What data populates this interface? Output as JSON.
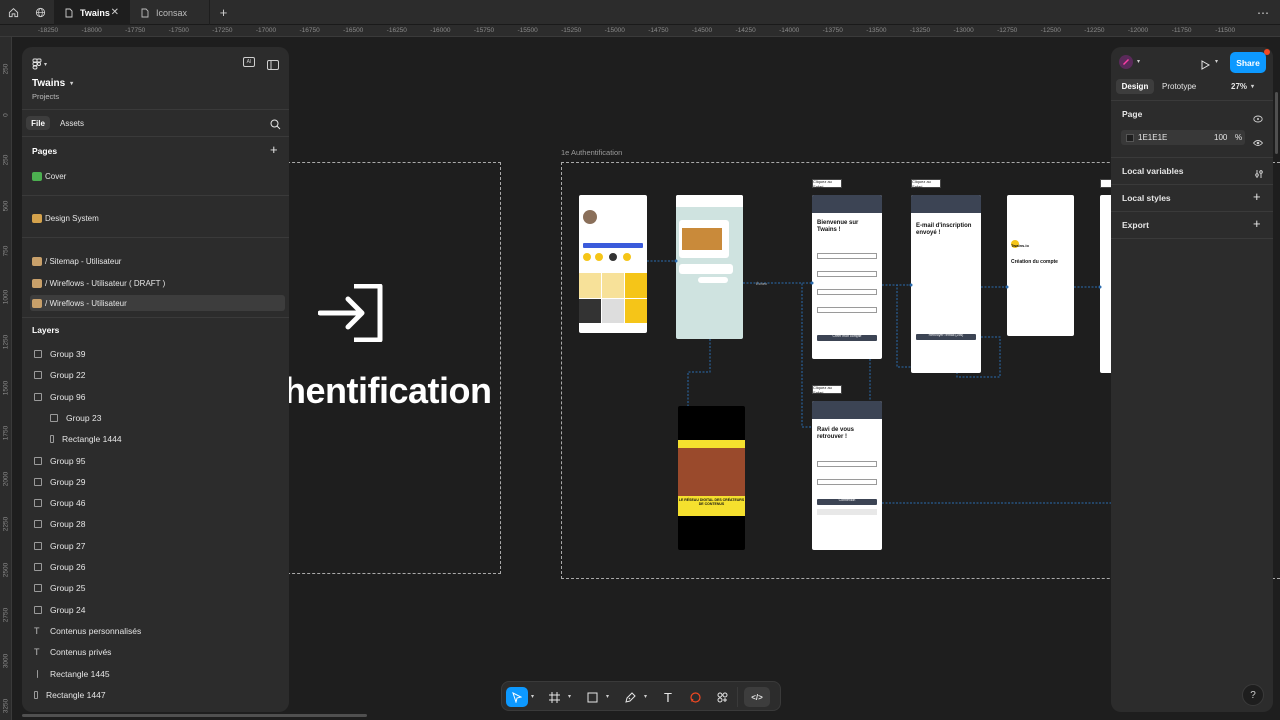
{
  "tabs": [
    {
      "label": "Twains",
      "active": true
    },
    {
      "label": "Iconsax",
      "active": false
    }
  ],
  "ruler_top": [
    "-18250",
    "-18000",
    "-17750",
    "-17500",
    "-17250",
    "-17000",
    "-16750",
    "-16500",
    "-16250",
    "-16000",
    "-15750",
    "-15500",
    "-15250",
    "-15000",
    "-14750",
    "-14500",
    "-14250",
    "-14000",
    "-13750",
    "-13500",
    "-13250",
    "-13000",
    "-12750",
    "-12500",
    "-12250",
    "-12000",
    "-11750",
    "-11500"
  ],
  "ruler_left": [
    "250",
    "0",
    "250",
    "500",
    "750",
    "1000",
    "1250",
    "1500",
    "1750",
    "2000",
    "2250",
    "2500",
    "2750",
    "3000",
    "3250"
  ],
  "project": {
    "name": "Twains",
    "subtitle": "Projects"
  },
  "panel_tabs": {
    "file": "File",
    "assets": "Assets"
  },
  "pages": {
    "heading": "Pages",
    "items": [
      {
        "label": "Cover",
        "emoji_color": "#4caf50"
      },
      {
        "label": "Design System",
        "emoji_color": "#d4a24c"
      },
      {
        "label": "/ Sitemap - Utilisateur",
        "emoji_color": "#c8a06a"
      },
      {
        "label": "/ Wireflows - Utilisateur ( DRAFT )",
        "emoji_color": "#c8a06a"
      },
      {
        "label": "/ Wireflows - Utilisateur",
        "emoji_color": "#c8a06a",
        "selected": true
      }
    ]
  },
  "layers": {
    "heading": "Layers",
    "items": [
      {
        "label": "Group 39",
        "type": "group"
      },
      {
        "label": "Group 22",
        "type": "group"
      },
      {
        "label": "Group 96",
        "type": "group"
      },
      {
        "label": "Group 23",
        "type": "group",
        "indent": 1
      },
      {
        "label": "Rectangle 1444",
        "type": "rect",
        "indent": 1
      },
      {
        "label": "Group 95",
        "type": "group"
      },
      {
        "label": "Group 29",
        "type": "group"
      },
      {
        "label": "Group 46",
        "type": "group"
      },
      {
        "label": "Group 28",
        "type": "group"
      },
      {
        "label": "Group 27",
        "type": "group"
      },
      {
        "label": "Group 26",
        "type": "group"
      },
      {
        "label": "Group 25",
        "type": "group"
      },
      {
        "label": "Group 24",
        "type": "group"
      },
      {
        "label": "Contenus personnalisés",
        "type": "text"
      },
      {
        "label": "Contenus privés",
        "type": "text"
      },
      {
        "label": "Rectangle 1445",
        "type": "line"
      },
      {
        "label": "Rectangle 1447",
        "type": "rect"
      }
    ]
  },
  "canvas": {
    "cover_title": "hentification",
    "section_label": "1e Authentification",
    "screens": {
      "signup_title": "Bienvenue sur Twains !",
      "signup_btn": "Créer mon compte",
      "email_title": "E-mail d'inscription envoyé !",
      "email_btn": "Renvoyer l'email (25s)",
      "confirm_title": "Création du compte",
      "confirm_brand": "Twains.io",
      "login_title": "Ravi de vous retrouver !",
      "login_btn": "Connexion",
      "flow_label": "Échec",
      "tag": "Cliquez au Safari",
      "video_banner": "LE RÉSEAU DIGITAL DES CRÉATEURS DE CONTENUS"
    }
  },
  "right": {
    "tabs": {
      "design": "Design",
      "prototype": "Prototype"
    },
    "zoom": "27%",
    "share": "Share",
    "page_section": "Page",
    "page_color": "1E1E1E",
    "page_opacity": "100",
    "page_opacity_unit": "%",
    "local_variables": "Local variables",
    "local_styles": "Local styles",
    "export": "Export"
  },
  "colors": {
    "accent": "#0d99ff",
    "canvas": "#1e1e1e",
    "panel": "#2c2c2c"
  }
}
